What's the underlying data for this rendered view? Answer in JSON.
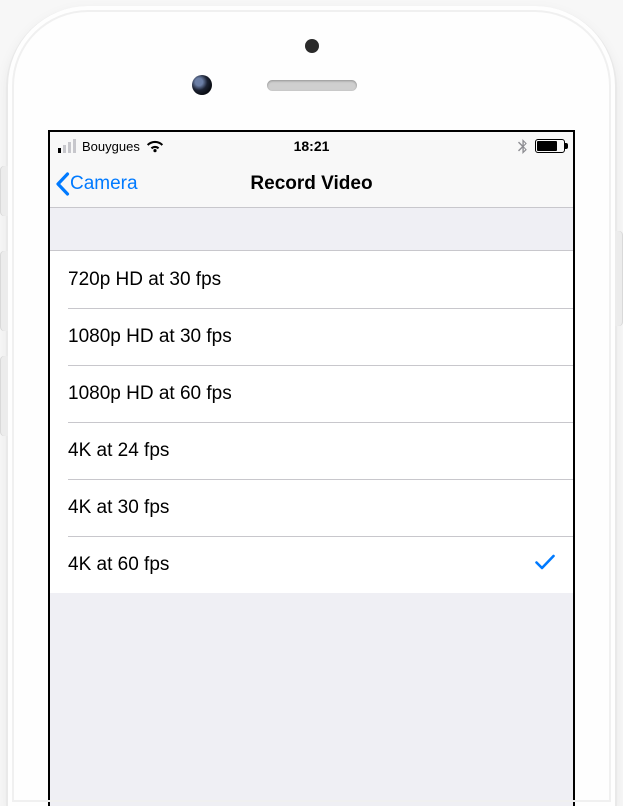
{
  "status": {
    "carrier": "Bouygues",
    "time": "18:21"
  },
  "nav": {
    "back": "Camera",
    "title": "Record Video"
  },
  "options": [
    {
      "label": "720p HD at 30 fps",
      "selected": false
    },
    {
      "label": "1080p HD at 30 fps",
      "selected": false
    },
    {
      "label": "1080p HD at 60 fps",
      "selected": false
    },
    {
      "label": "4K at 24 fps",
      "selected": false
    },
    {
      "label": "4K at 30 fps",
      "selected": false
    },
    {
      "label": "4K at 60 fps",
      "selected": true
    }
  ]
}
